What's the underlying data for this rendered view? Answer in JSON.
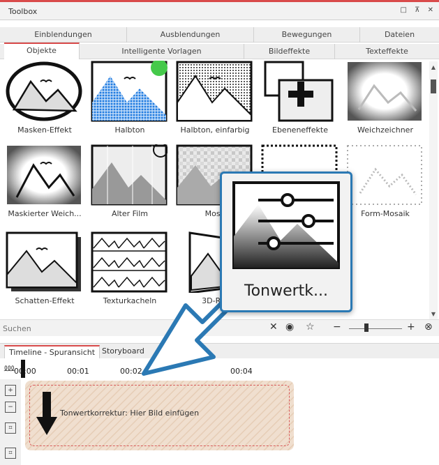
{
  "window": {
    "title": "Toolbox",
    "controls": [
      "□",
      "⊼",
      "✕"
    ]
  },
  "tabs_row1": [
    {
      "label": "Einblendungen"
    },
    {
      "label": "Ausblendungen"
    },
    {
      "label": "Bewegungen"
    },
    {
      "label": "Dateien"
    }
  ],
  "tabs_row2": [
    {
      "label": "Objekte",
      "active": true
    },
    {
      "label": "Intelligente Vorlagen"
    },
    {
      "label": "Bildeffekte"
    },
    {
      "label": "Texteffekte"
    }
  ],
  "tiles": [
    {
      "label": "Masken-Effekt"
    },
    {
      "label": "Halbton"
    },
    {
      "label": "Halbton, einfarbig"
    },
    {
      "label": "Ebeneneffekte"
    },
    {
      "label": "Weichzeichner"
    },
    {
      "label": "Maskierter Weich..."
    },
    {
      "label": "Alter Film"
    },
    {
      "label": "Mosa"
    },
    {
      "label": ""
    },
    {
      "label": "Form-Mosaik"
    },
    {
      "label": "Schatten-Effekt"
    },
    {
      "label": "Texturkacheln"
    },
    {
      "label": "3D-Rot"
    }
  ],
  "search": {
    "placeholder": "Suchen"
  },
  "timeline": {
    "tabs": [
      {
        "label": "Timeline - Spuransicht",
        "active": true
      },
      {
        "label": "Storyboard"
      }
    ],
    "ruler": [
      "00:00",
      "00:01",
      "00:02",
      "00:04"
    ],
    "dropzone_text": "Tonwertkorrektur: Hier Bild einfügen"
  },
  "popup": {
    "label": "Tonwertk..."
  },
  "colors": {
    "accent": "#d94b4b",
    "popup_border": "#2b79b4",
    "halbton_blue": "#1f7be0",
    "halbton_green": "#45c94a"
  }
}
